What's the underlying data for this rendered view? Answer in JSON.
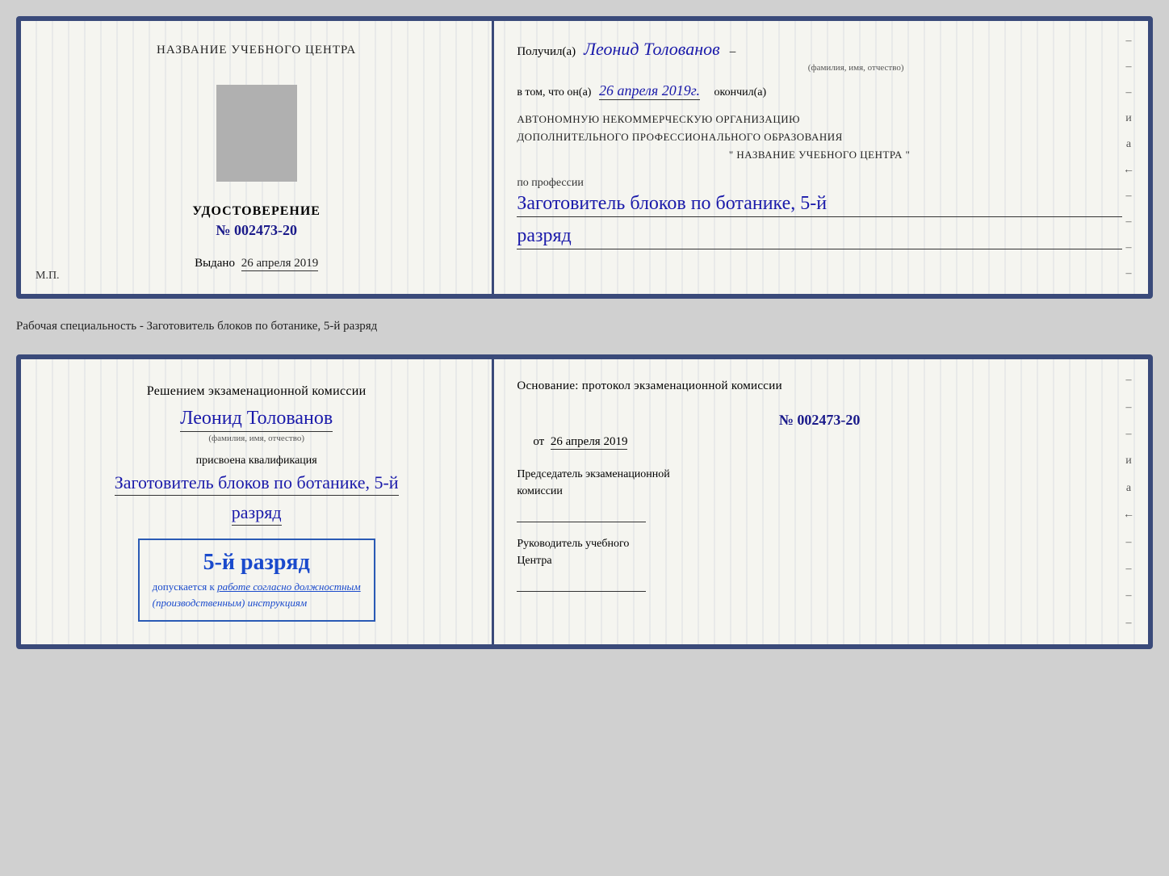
{
  "page": {
    "background": "#d0d0d0"
  },
  "top_doc": {
    "left": {
      "training_center_label": "НАЗВАНИЕ УЧЕБНОГО ЦЕНТРА",
      "cert_label": "УДОСТОВЕРЕНИЕ",
      "cert_number": "№ 002473-20",
      "issued_label": "Выдано",
      "issued_date": "26 апреля 2019",
      "mp_label": "М.П."
    },
    "right": {
      "received_label": "Получил(а)",
      "recipient_name": "Леонид Толованов",
      "fio_sublabel": "(фамилия, имя, отчество)",
      "certified_text": "в том, что он(а)",
      "certified_date": "26 апреля 2019г.",
      "finished_label": "окончил(а)",
      "org_line1": "АВТОНОМНУЮ НЕКОММЕРЧЕСКУЮ ОРГАНИЗАЦИЮ",
      "org_line2": "ДОПОЛНИТЕЛЬНОГО ПРОФЕССИОНАЛЬНОГО ОБРАЗОВАНИЯ",
      "org_name": "\" НАЗВАНИЕ УЧЕБНОГО ЦЕНТРА \"",
      "profession_label": "по профессии",
      "profession_name": "Заготовитель блоков по ботанике, 5-й",
      "razryad": "разряд",
      "dashes": [
        "-",
        "-",
        "-",
        "и",
        "а",
        "←",
        "-",
        "-",
        "-",
        "-"
      ]
    }
  },
  "separator": {
    "text": "Рабочая специальность - Заготовитель блоков по ботанике, 5-й разряд"
  },
  "bottom_doc": {
    "left": {
      "commission_text1": "Решением экзаменационной комиссии",
      "person_name": "Леонид Толованов",
      "fio_sublabel": "(фамилия, имя, отчество)",
      "assigned_text": "присвоена квалификация",
      "qualification": "Заготовитель блоков по ботанике, 5-й",
      "razryad": "разряд",
      "stamp_rank": "5-й разряд",
      "stamp_allowed": "допускается к",
      "stamp_work": "работе согласно должностным",
      "stamp_instructions": "(производственным) инструкциям"
    },
    "right": {
      "basis_text": "Основание: протокол экзаменационной комиссии",
      "protocol_number": "№  002473-20",
      "date_from_prefix": "от",
      "date_from": "26 апреля 2019",
      "chairman_title1": "Председатель экзаменационной",
      "chairman_title2": "комиссии",
      "director_title1": "Руководитель учебного",
      "director_title2": "Центра",
      "dashes": [
        "-",
        "-",
        "-",
        "и",
        "а",
        "←",
        "-",
        "-",
        "-",
        "-"
      ]
    }
  }
}
